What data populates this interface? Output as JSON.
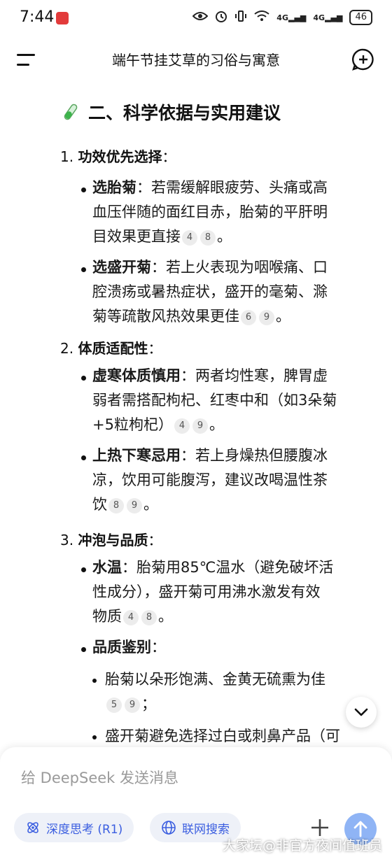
{
  "status_bar": {
    "time": "7:44",
    "signal1": "4G",
    "signal2": "4G",
    "battery": "46"
  },
  "header": {
    "title": "端午节挂艾草的习俗与寓意"
  },
  "section": {
    "heading": "二、科学依据与实用建议",
    "items": [
      {
        "number": "1.",
        "label": "功效优先选择",
        "bullets": [
          {
            "bold": "选胎菊",
            "lines": [
              "：若需缓解眼疲劳、头痛或高",
              "血压伴随的面红目赤，胎菊的平肝明",
              "目效果更直接"
            ],
            "cites": [
              "4",
              "8"
            ],
            "end": "。"
          },
          {
            "bold": "选盛开菊",
            "lines": [
              "：若上火表现为咽喉痛、口",
              "腔溃疡或暑热症状，盛开的毫菊、滁",
              "菊等疏散风热效果更佳"
            ],
            "cites": [
              "6",
              "9"
            ],
            "end": "。"
          }
        ]
      },
      {
        "number": "2.",
        "label": "体质适配性",
        "bullets": [
          {
            "bold": "虚寒体质慎用",
            "lines": [
              "：两者均性寒，脾胃虚",
              "弱者需搭配枸杞、红枣中和（如3朵菊",
              "+5粒枸杞）"
            ],
            "cites": [
              "4",
              "9"
            ],
            "end": "。"
          },
          {
            "bold": "上热下寒忌用",
            "lines": [
              "：若上身燥热但腰腹冰",
              "凉，饮用可能腹泻，建议改喝温性茶",
              "饮"
            ],
            "cites": [
              "8",
              "9"
            ],
            "end": "。"
          }
        ]
      },
      {
        "number": "3.",
        "label": "冲泡与品质",
        "bullets": [
          {
            "bold": "水温",
            "lines": [
              "：胎菊用85℃温水（避免破坏活",
              "性成分），盛开菊可用沸水激发有效",
              "物质"
            ],
            "cites": [
              "4",
              "8"
            ],
            "end": "。"
          },
          {
            "bold": "品质鉴别",
            "lines": [
              "："
            ],
            "cites": [],
            "end": ""
          }
        ],
        "sub_bullets": [
          {
            "lines": [
              "胎菊以朵形饱满、金黄无硫熏为佳"
            ],
            "cites": [
              "5",
              "9"
            ],
            "end": "；"
          },
          {
            "lines": [
              "盛开菊避免选择过白或刺鼻产品（可"
            ]
          }
        ]
      }
    ]
  },
  "composer": {
    "placeholder": "给 DeepSeek 发送消息",
    "chip_deep_think": "深度思考 (R1)",
    "chip_web_search": "联网搜索"
  },
  "watermark": "大家坛@非官方夜间值班员",
  "colors": {
    "accent": "#3b5ee0",
    "send_button": "#8fb4f5",
    "chip_bg": "#eef1f8",
    "cite_bg": "#ececec"
  }
}
